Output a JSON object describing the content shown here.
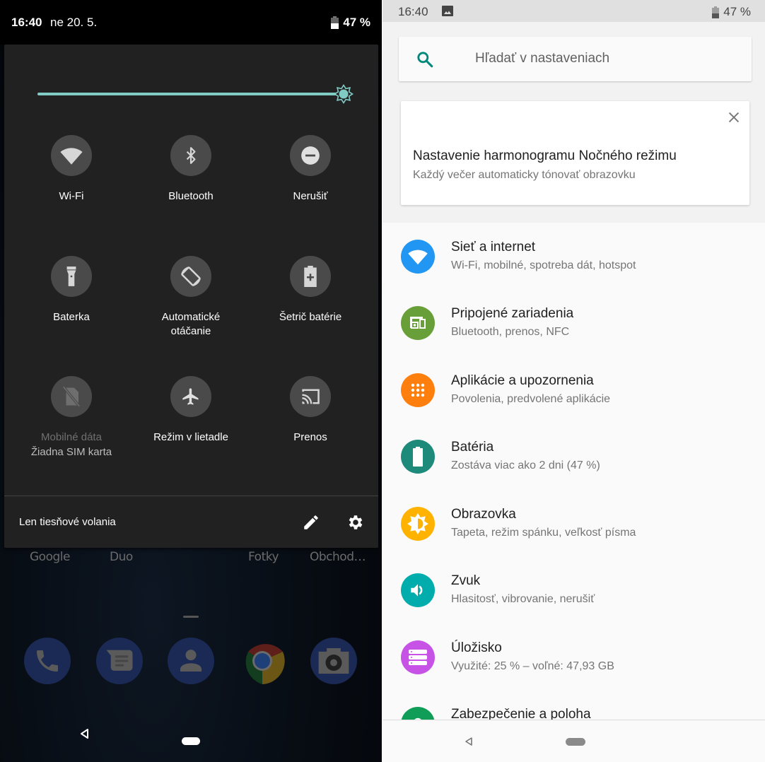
{
  "left": {
    "status_bar": {
      "time": "16:40",
      "date": "ne 20. 5.",
      "battery": "47 %"
    },
    "quick_settings": {
      "brightness": {
        "level_percent": 100,
        "accent": "#80cbc4"
      },
      "tiles": [
        {
          "id": "wifi",
          "label": "Wi-Fi",
          "icon": "wifi-icon"
        },
        {
          "id": "bluetooth",
          "label": "Bluetooth",
          "icon": "bluetooth-icon"
        },
        {
          "id": "dnd",
          "label": "Nerušiť",
          "icon": "do-not-disturb-icon"
        },
        {
          "id": "flashlight",
          "label": "Baterka",
          "icon": "flashlight-icon"
        },
        {
          "id": "autorotate",
          "label": "Automatické otáčanie",
          "label_line1": "Automatické",
          "label_line2": "otáčanie",
          "icon": "auto-rotate-icon"
        },
        {
          "id": "battery-saver",
          "label": "Šetrič batérie",
          "icon": "battery-saver-icon"
        },
        {
          "id": "mobile-data",
          "label": "Mobilné dáta",
          "sublabel": "Žiadna SIM karta",
          "icon": "no-sim-icon",
          "disabled": true
        },
        {
          "id": "airplane",
          "label": "Režim v lietadle",
          "icon": "airplane-icon"
        },
        {
          "id": "cast",
          "label": "Prenos",
          "icon": "cast-icon"
        }
      ],
      "footer": {
        "carrier_text": "Len tiesňové volania",
        "edit_icon": "pencil-icon",
        "settings_icon": "gear-icon"
      }
    },
    "home": {
      "app_labels": [
        "Google",
        "Duo",
        "Fotky",
        "Obchod…"
      ],
      "dock": [
        {
          "name": "Telefón",
          "icon": "phone-icon"
        },
        {
          "name": "Správy",
          "icon": "messages-icon"
        },
        {
          "name": "Kontakty",
          "icon": "contacts-icon"
        },
        {
          "name": "Chrome",
          "icon": "chrome-icon"
        },
        {
          "name": "Fotoaparát",
          "icon": "camera-icon"
        }
      ]
    }
  },
  "right": {
    "status_bar": {
      "time": "16:40",
      "battery": "47 %"
    },
    "search": {
      "placeholder": "Hľadať v nastaveniach",
      "accent": "#00897b"
    },
    "suggestion_card": {
      "title": "Nastavenie harmonogramu Nočného režimu",
      "subtitle": "Každý večer automaticky tónovať obrazovku"
    },
    "settings": [
      {
        "title": "Sieť a internet",
        "subtitle": "Wi-Fi, mobilné, spotreba dát, hotspot",
        "color": "#2196f3",
        "icon": "wifi-icon"
      },
      {
        "title": "Pripojené zariadenia",
        "subtitle": "Bluetooth, prenos, NFC",
        "color": "#689f38",
        "icon": "devices-icon"
      },
      {
        "title": "Aplikácie a upozornenia",
        "subtitle": "Povolenia, predvolené aplikácie",
        "color": "#ff7f0e",
        "icon": "apps-grid-icon"
      },
      {
        "title": "Batéria",
        "subtitle": "Zostáva viac ako 2 dni (47 %)",
        "color": "#1e8a7a",
        "icon": "battery-icon"
      },
      {
        "title": "Obrazovka",
        "subtitle": "Tapeta, režim spánku, veľkosť písma",
        "color": "#ffb300",
        "icon": "brightness-icon"
      },
      {
        "title": "Zvuk",
        "subtitle": "Hlasitosť, vibrovanie, nerušiť",
        "color": "#00acac",
        "icon": "volume-icon"
      },
      {
        "title": "Úložisko",
        "subtitle": "Využité: 25 % – voľné: 47,93 GB",
        "color": "#c653e6",
        "icon": "storage-icon"
      },
      {
        "title": "Zabezpečenie a poloha",
        "subtitle": "",
        "color": "#0f9d58",
        "icon": "lock-icon"
      }
    ]
  }
}
